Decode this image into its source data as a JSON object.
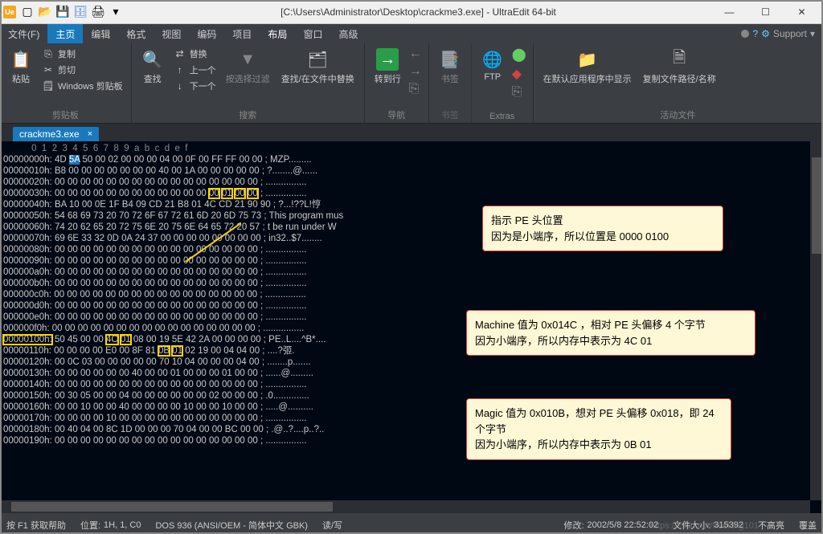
{
  "title": "[C:\\Users\\Administrator\\Desktop\\crackme3.exe] - UltraEdit 64-bit",
  "toolbar_icons": [
    "new",
    "open",
    "save",
    "saveall",
    "print"
  ],
  "menu": {
    "items": [
      "文件(F)",
      "主页",
      "编辑",
      "格式",
      "视图",
      "编码",
      "项目",
      "布局",
      "窗口",
      "高级"
    ],
    "active": "主页",
    "support": "Support"
  },
  "ribbon": {
    "groups": [
      {
        "label": "剪贴板",
        "items": {
          "paste": "粘贴",
          "copy": "复制",
          "cut": "剪切",
          "winclip": "Windows 剪贴板"
        }
      },
      {
        "label": "搜索",
        "items": {
          "find": "查找",
          "replace": "替换",
          "prev": "上一个",
          "next": "下一个",
          "selfilter": "按选择过滤",
          "findfiles": "查找/在文件中替换"
        }
      },
      {
        "label": "导航",
        "items": {
          "gotoline": "转到行"
        }
      },
      {
        "label": "书签",
        "items": {
          "bookmark": "书签"
        }
      },
      {
        "label": "Extras",
        "items": {
          "ftp": "FTP"
        }
      },
      {
        "label": "活动文件",
        "items": {
          "showexplorer": "在默认应用程序中显示",
          "copypath": "复制文件路径/名称"
        }
      }
    ]
  },
  "filetab": {
    "name": "crackme3.exe",
    "close": "×"
  },
  "hex": {
    "ruler": "           0  1  2  3  4  5  6  7  8  9  a  b  c  d  e  f",
    "lines": [
      {
        "a": "00000000h:",
        "b": "4D 5A 50 00 02 00 00 00 04 00 0F 00 FF FF 00 00",
        "t": "; MZP........."
      },
      {
        "a": "00000010h:",
        "b": "B8 00 00 00 00 00 00 00 40 00 1A 00 00 00 00 00",
        "t": "; ?........@......"
      },
      {
        "a": "00000020h:",
        "b": "00 00 00 00 00 00 00 00 00 00 00 00 00 00 00 00",
        "t": "; ................"
      },
      {
        "a": "00000030h:",
        "b": "00 00 00 00 00 00 00 00 00 00 00 00 00 01 00 00",
        "t": "; ................"
      },
      {
        "a": "00000040h:",
        "b": "BA 10 00 0E 1F B4 09 CD 21 B8 01 4C CD 21 90 90",
        "t": "; ?...!??L!悙"
      },
      {
        "a": "00000050h:",
        "b": "54 68 69 73 20 70 72 6F 67 72 61 6D 20 6D 75 73",
        "t": "; This program mus"
      },
      {
        "a": "00000060h:",
        "b": "74 20 62 65 20 72 75 6E 20 75 6E 64 65 72 20 57",
        "t": "; t be run under W"
      },
      {
        "a": "00000070h:",
        "b": "69 6E 33 32 0D 0A 24 37 00 00 00 00 00 00 00 00",
        "t": "; in32..$7........"
      },
      {
        "a": "00000080h:",
        "b": "00 00 00 00 00 00 00 00 00 00 00 00 00 00 00 00",
        "t": "; ................"
      },
      {
        "a": "00000090h:",
        "b": "00 00 00 00 00 00 00 00 00 00 00 00 00 00 00 00",
        "t": "; ................"
      },
      {
        "a": "000000a0h:",
        "b": "00 00 00 00 00 00 00 00 00 00 00 00 00 00 00 00",
        "t": "; ................"
      },
      {
        "a": "000000b0h:",
        "b": "00 00 00 00 00 00 00 00 00 00 00 00 00 00 00 00",
        "t": "; ................"
      },
      {
        "a": "000000c0h:",
        "b": "00 00 00 00 00 00 00 00 00 00 00 00 00 00 00 00",
        "t": "; ................"
      },
      {
        "a": "000000d0h:",
        "b": "00 00 00 00 00 00 00 00 00 00 00 00 00 00 00 00",
        "t": "; ................"
      },
      {
        "a": "000000e0h:",
        "b": "00 00 00 00 00 00 00 00 00 00 00 00 00 00 00 00",
        "t": "; ................"
      },
      {
        "a": "000000f0h:",
        "b": "00 00 00 00 00 00 00 00 00 00 00 00 00 00 00 00",
        "t": "; ................"
      },
      {
        "a": "00000100h:",
        "b": "50 45 00 00 4C 01 08 00 19 5E 42 2A 00 00 00 00",
        "t": "; PE..L....^B*...."
      },
      {
        "a": "00000110h:",
        "b": "00 00 00 00 E0 00 8F 81 0B 01 02 19 00 04 04 00",
        "t": "; ....?弬."
      },
      {
        "a": "00000120h:",
        "b": "00 0C 03 00 00 00 00 00 70 10 04 00 00 00 04 00",
        "t": "; ........p......."
      },
      {
        "a": "00000130h:",
        "b": "00 00 00 00 00 00 40 00 00 01 00 00 00 01 00 00",
        "t": "; ......@........."
      },
      {
        "a": "00000140h:",
        "b": "00 00 00 00 00 00 00 00 00 00 00 00 00 00 00 00",
        "t": "; ................"
      },
      {
        "a": "00000150h:",
        "b": "00 30 05 00 00 04 00 00 00 00 00 00 02 00 00 00",
        "t": "; .0.............."
      },
      {
        "a": "00000160h:",
        "b": "00 00 10 00 00 40 00 00 00 00 10 00 00 10 00 00",
        "t": "; .....@.........."
      },
      {
        "a": "00000170h:",
        "b": "00 00 00 00 10 00 00 00 00 00 00 00 00 00 00 00",
        "t": "; ................"
      },
      {
        "a": "00000180h:",
        "b": "00 40 04 00 8C 1D 00 00 00 70 04 00 00 BC 00 00",
        "t": "; .@..?....p..?.."
      },
      {
        "a": "00000190h:",
        "b": "00 00 00 00 00 00 00 00 00 00 00 00 00 00 00 00",
        "t": "; ................"
      }
    ],
    "highlights": {
      "sel_row": 0,
      "sel_col": 1,
      "boxes": [
        {
          "row": 3,
          "col_start": 12,
          "col_end": 15
        },
        {
          "row": 16,
          "addr": true
        },
        {
          "row": 16,
          "col_start": 4,
          "col_end": 5
        },
        {
          "row": 17,
          "col_start": 8,
          "col_end": 9
        }
      ]
    }
  },
  "callouts": [
    {
      "id": "c1",
      "lines": [
        "指示 PE 头位置",
        "因为是小端序，所以位置是 0000 0100"
      ]
    },
    {
      "id": "c2",
      "lines": [
        "Machine 值为 0x014C ，相对 PE 头偏移 4 个字节",
        "因为小端序，所以内存中表示为 4C 01"
      ]
    },
    {
      "id": "c3",
      "lines": [
        "Magic 值为 0x010B，想对 PE 头偏移 0x018，即 24 个字节",
        "因为小端序，所以内存中表示为 0B 01"
      ]
    }
  ],
  "status": {
    "help": "按 F1 获取帮助",
    "pos_label": "位置:",
    "pos": "1H, 1, C0",
    "enc": "DOS  936  (ANSI/OEM - 简体中文 GBK)",
    "rw": "读/写",
    "mod_label": "修改:",
    "mod": "2002/5/8 22:52:02",
    "size_label": "文件大小:",
    "size": "315392",
    "hl": "不高亮",
    "ovr": "覆盖"
  },
  "watermark": "https://csdn.net/freeking101"
}
